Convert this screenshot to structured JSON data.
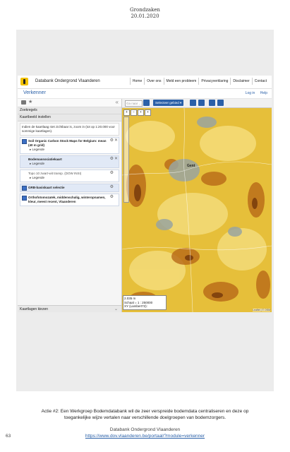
{
  "header": {
    "section": "Grondzaken",
    "date": "20.01.2020"
  },
  "screenshot": {
    "app_title": "Databank Ondergrond Vlaanderen",
    "nav": [
      "Home",
      "Over ons",
      "Meld een probleem",
      "Privacyverklaring",
      "Disclaimer",
      "Contact"
    ],
    "subtitle": "Verkenner",
    "login": "Log in",
    "help": "Help",
    "left_panel": {
      "search": "Zoekregels",
      "map_settings": "Kaartbeeld instellen",
      "note": "Indien de kaartlaag niet zichtbaar is, zoom in (tot op 1:20.000 voor sommige kaartlagen).",
      "layers": [
        {
          "label": "Soil Organic Carbon Stock Maps for Belgium: mean (40 m grid)",
          "legend": "Legende",
          "checked": true,
          "highlighted": false
        },
        {
          "label": "Bodemassociatiekaart",
          "legend": "Legende",
          "checked": false,
          "highlighted": true
        },
        {
          "label": "Topo 10 zwart-wit transp. (DOW INSI)",
          "legend": "Legende",
          "checked": false,
          "highlighted": false
        },
        {
          "label": "GRB-basiskaart selectie",
          "legend": "",
          "checked": true,
          "highlighted": true
        },
        {
          "label": "Orthofotomozaïek, middenschalig, winteropnamen, kleur, meest recent, Vlaanderen",
          "legend": "",
          "checked": true,
          "highlighted": false
        }
      ],
      "bottom": "Kaartlagen kiezen"
    },
    "map": {
      "search_placeholder": "Ga naar …",
      "select_area": "Selecteer gebied ▾",
      "place": "Gent",
      "scale_distance": "2.035 m",
      "scale": "Schaal = 1 : 250000",
      "coords": "XY (Lambert72):",
      "credit": "Leaflet | © OSM"
    }
  },
  "caption": "Actie #2: Een Werkgroep Bodemdatabank wil de zeer verspreide bodemdata centraliseren en deze op toegankelijke wijze vertalen naar verschillende doelgroepen van bodemzorgers.",
  "footer": {
    "org": "Databank Ondergrond Vlaanderen",
    "url": "https://www.dov.vlaanderen.be/portaal/?module=verkenner",
    "page": "63"
  },
  "colors": {
    "accent": "#2a60a8",
    "map_yellow": "#e6bf3a",
    "map_brown": "#8a4a10"
  }
}
